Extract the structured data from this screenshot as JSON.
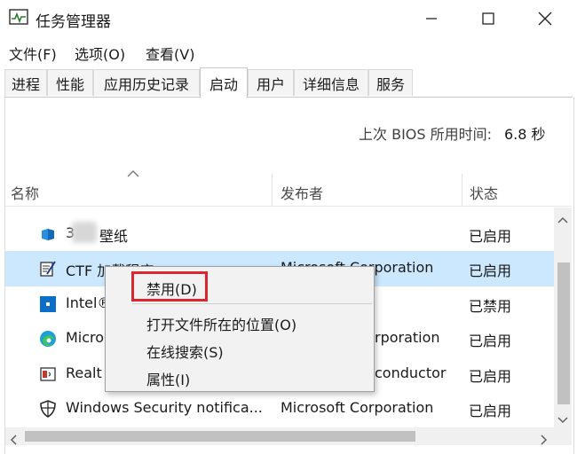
{
  "window": {
    "title": "任务管理器",
    "icon": "task-manager-icon"
  },
  "menu": [
    "文件(F)",
    "选项(O)",
    "查看(V)"
  ],
  "tabs": [
    "进程",
    "性能",
    "应用历史记录",
    "启动",
    "用户",
    "详细信息",
    "服务"
  ],
  "active_tab": "启动",
  "bios": {
    "label": "上次 BIOS 所用时间:",
    "value": "6.8 秒"
  },
  "columns": {
    "name": "名称",
    "publisher": "发布者",
    "status": "状态"
  },
  "rows": [
    {
      "name": "3  壁纸",
      "name_prefix": "3",
      "name_suffix": "壁纸",
      "publisher": "",
      "status": "已启用",
      "icon": "wallpaper-app-icon"
    },
    {
      "name": "CTF 加载程序",
      "publisher": "Microsoft Corporation",
      "status": "已启用",
      "icon": "notepad-pen-icon",
      "selected": true
    },
    {
      "name": "Intel®",
      "publisher": "",
      "status": "已禁用",
      "icon": "intel-square-icon"
    },
    {
      "name": "Micro",
      "publisher": "rporation",
      "status": "已启用",
      "icon": "edge-icon"
    },
    {
      "name": "Realt",
      "publisher": "conductor",
      "status": "已启用",
      "icon": "realtek-audio-icon"
    },
    {
      "name": "Windows Security notifica...",
      "publisher": "Microsoft Corporation",
      "status": "已启用",
      "icon": "shield-icon"
    }
  ],
  "context_menu": {
    "items": [
      "禁用(D)",
      "打开文件所在的位置(O)",
      "在线搜索(S)",
      "属性(I)"
    ],
    "highlighted": "禁用(D)"
  },
  "colors": {
    "selection": "#cce8ff",
    "highlight_box": "#d9262f",
    "menu_bg": "#f2f2f2"
  }
}
